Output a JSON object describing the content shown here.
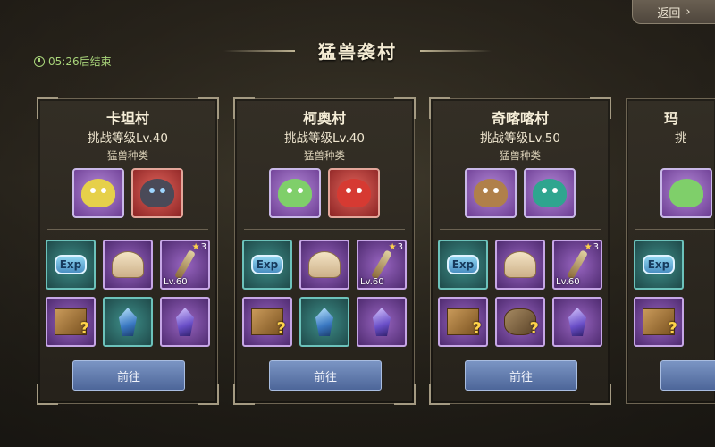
{
  "header": {
    "title": "猛兽袭村",
    "back_label": "返回",
    "back_icon": "chevron-right-icon",
    "timer_text": "05:26后结束",
    "timer_icon": "clock-icon"
  },
  "villages": [
    {
      "name": "卡坦村",
      "level": "挑战等级Lv.40",
      "beast_type_label": "猛兽种类",
      "beasts": [
        "yellow-dino-beast",
        "dark-dragon-beast"
      ],
      "items": [
        {
          "kind": "exp",
          "label": "Exp"
        },
        {
          "kind": "shell"
        },
        {
          "kind": "staff",
          "stars": "3",
          "level": "Lv.60"
        },
        {
          "kind": "book-mystery"
        },
        {
          "kind": "crystal-blue"
        },
        {
          "kind": "crystal-violet"
        }
      ],
      "button": "前往"
    },
    {
      "name": "柯奥村",
      "level": "挑战等级Lv.40",
      "beast_type_label": "猛兽种类",
      "beasts": [
        "green-dino-beast",
        "red-dragon-beast"
      ],
      "items": [
        {
          "kind": "exp",
          "label": "Exp"
        },
        {
          "kind": "shell"
        },
        {
          "kind": "staff",
          "stars": "3",
          "level": "Lv.60"
        },
        {
          "kind": "book-mystery"
        },
        {
          "kind": "crystal-blue"
        },
        {
          "kind": "crystal-violet"
        }
      ],
      "button": "前往"
    },
    {
      "name": "奇喀喀村",
      "level": "挑战等级Lv.50",
      "beast_type_label": "猛兽种类",
      "beasts": [
        "brown-golem-beast",
        "teal-dragon-beast"
      ],
      "items": [
        {
          "kind": "exp",
          "label": "Exp"
        },
        {
          "kind": "shell"
        },
        {
          "kind": "staff",
          "stars": "3",
          "level": "Lv.60"
        },
        {
          "kind": "book-mystery"
        },
        {
          "kind": "pet-mystery"
        },
        {
          "kind": "crystal-violet"
        }
      ],
      "button": "前往"
    },
    {
      "name": "玛",
      "level": "挑",
      "button": "",
      "items": [
        {
          "kind": "exp",
          "label": "Exp"
        },
        {
          "kind": "book-mystery"
        }
      ]
    }
  ],
  "colors": {
    "timer": "#a8d47a",
    "button": "#5c77ab",
    "card_border": "#6e6553"
  }
}
